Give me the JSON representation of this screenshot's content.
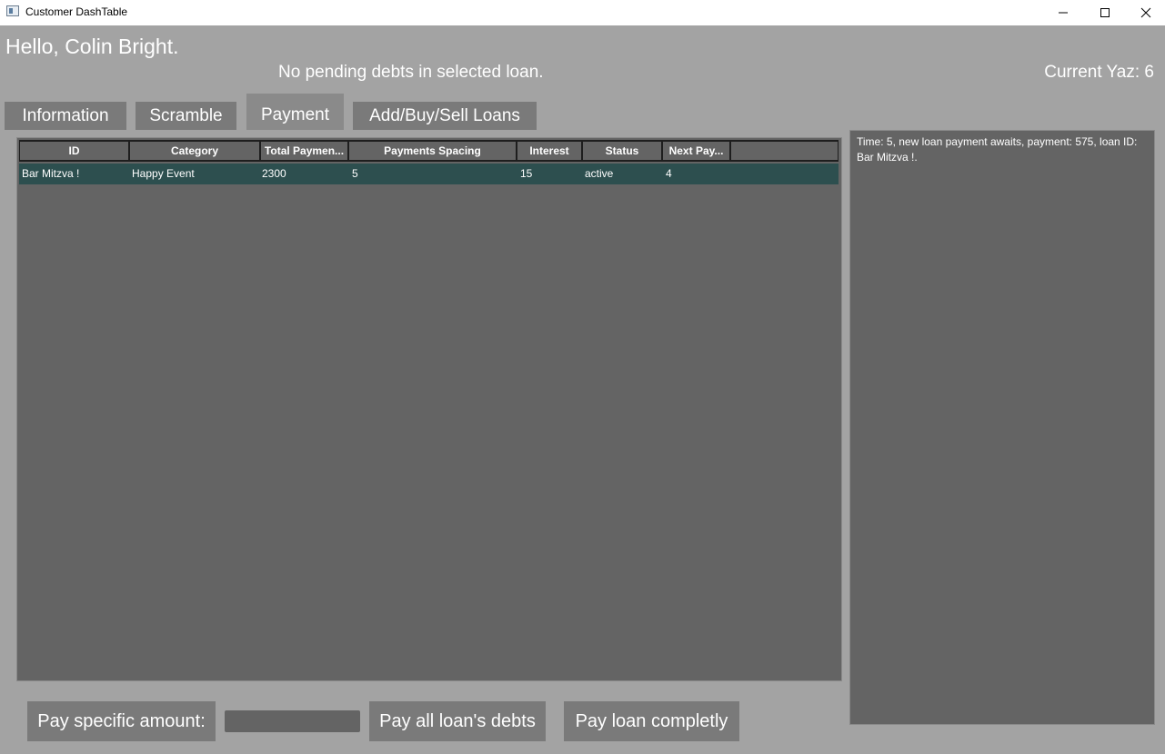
{
  "window": {
    "title": "Customer DashTable",
    "controls": {
      "minimize": "minimize-icon",
      "maximize": "maximize-icon",
      "close": "close-icon"
    }
  },
  "header": {
    "greeting": "Hello, Colin Bright.",
    "status_message": "No pending debts in selected loan.",
    "current_yaz": "Current Yaz: 6"
  },
  "tabs": [
    {
      "label": "Information"
    },
    {
      "label": "Scramble"
    },
    {
      "label": "Payment",
      "selected": true
    },
    {
      "label": "Add/Buy/Sell Loans"
    }
  ],
  "loans_table": {
    "columns": [
      "ID",
      "Category",
      "Total Paymen...",
      "Payments Spacing",
      "Interest",
      "Status",
      "Next Pay..."
    ],
    "rows": [
      {
        "id": "Bar Mitzva !",
        "category": "Happy Event",
        "total_payment": "2300",
        "payments_spacing": "5",
        "interest": "15",
        "status": "active",
        "next_payment": "4"
      }
    ]
  },
  "notifications": {
    "text": "Time: 5, new loan payment awaits, payment: 575, loan ID: Bar Mitzva !."
  },
  "actions": {
    "pay_specific_label": "Pay specific amount:",
    "amount_input_value": "",
    "pay_all_debts_label": "Pay all loan's debts",
    "pay_completely_label": "Pay loan completly"
  },
  "colors": {
    "background": "#a3a3a3",
    "panel": "#646464",
    "selected_row": "#2d4f4f",
    "button": "#7a7a7a"
  }
}
